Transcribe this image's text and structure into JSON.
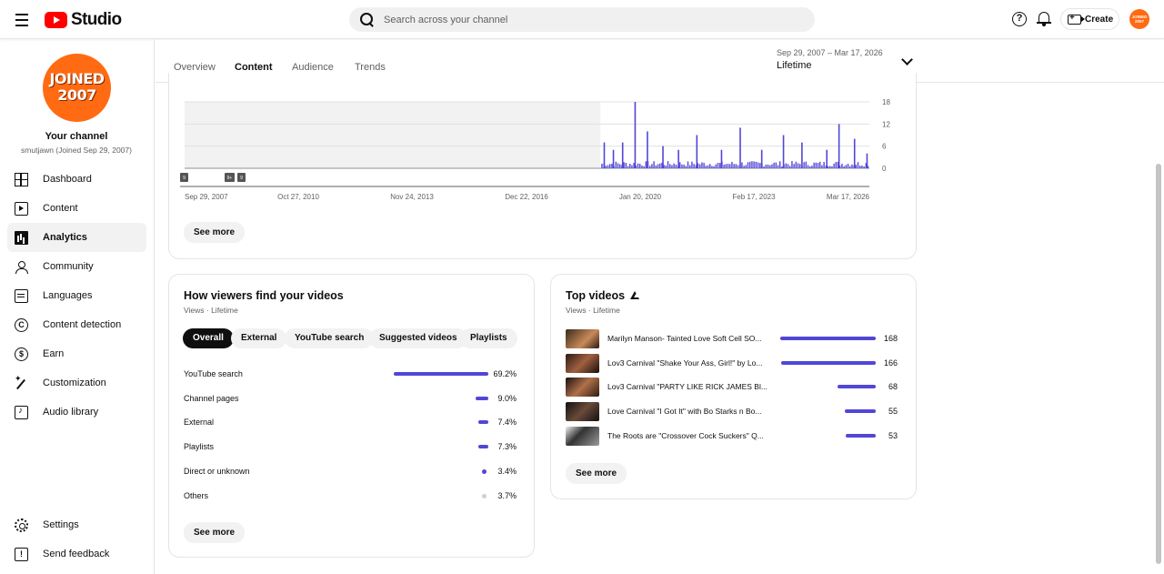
{
  "app": {
    "logo_text": "Studio"
  },
  "search": {
    "placeholder": "Search across your channel"
  },
  "header": {
    "create_label": "Create",
    "avatar_text": "JOINED 2007"
  },
  "sidebar": {
    "avatar_line1": "JOINED",
    "avatar_line2": "2007",
    "channel_title": "Your channel",
    "channel_handle": "smutjawn (Joined Sep 29, 2007)",
    "items": [
      {
        "label": "Dashboard",
        "icon": "dashboard-icon"
      },
      {
        "label": "Content",
        "icon": "content-icon"
      },
      {
        "label": "Analytics",
        "icon": "analytics-icon"
      },
      {
        "label": "Community",
        "icon": "community-icon"
      },
      {
        "label": "Languages",
        "icon": "languages-icon"
      },
      {
        "label": "Content detection",
        "icon": "copyright-icon"
      },
      {
        "label": "Earn",
        "icon": "dollar-icon"
      },
      {
        "label": "Customization",
        "icon": "wand-icon"
      },
      {
        "label": "Audio library",
        "icon": "audio-library-icon"
      }
    ],
    "bottom": [
      {
        "label": "Settings",
        "icon": "gear-icon"
      },
      {
        "label": "Send feedback",
        "icon": "feedback-icon"
      }
    ]
  },
  "tabs": [
    {
      "label": "Overview"
    },
    {
      "label": "Content",
      "active": true
    },
    {
      "label": "Audience"
    },
    {
      "label": "Trends"
    }
  ],
  "date_range": {
    "range": "Sep 29, 2007 – Mar 17, 2026",
    "value": "Lifetime"
  },
  "chart": {
    "see_more": "See more",
    "markers": [
      "9",
      "9+",
      "9"
    ]
  },
  "chart_data": {
    "type": "bar",
    "x_tick_labels": [
      "Sep 29, 2007",
      "Oct 27, 2010",
      "Nov 24, 2013",
      "Dec 22, 2016",
      "Jan 20, 2020",
      "Feb 17, 2023",
      "Mar 17, 2026"
    ],
    "y_tick_labels": [
      "18",
      "12",
      "6",
      "0"
    ],
    "ylim": [
      0,
      18
    ],
    "shaded_region_until": "2018-12",
    "grid": true,
    "colors": {
      "bar": "#5246d6",
      "shaded": "#f2f2f2"
    },
    "peaks": [
      {
        "x": "2019-01",
        "y": 7
      },
      {
        "x": "2019-04",
        "y": 5
      },
      {
        "x": "2019-07",
        "y": 7
      },
      {
        "x": "2019-11",
        "y": 18
      },
      {
        "x": "2020-03",
        "y": 10
      },
      {
        "x": "2020-08",
        "y": 6
      },
      {
        "x": "2021-01",
        "y": 5
      },
      {
        "x": "2021-07",
        "y": 9
      },
      {
        "x": "2022-03",
        "y": 5
      },
      {
        "x": "2022-09",
        "y": 11
      },
      {
        "x": "2023-04",
        "y": 5
      },
      {
        "x": "2023-11",
        "y": 9
      },
      {
        "x": "2024-05",
        "y": 7
      },
      {
        "x": "2025-01",
        "y": 5
      },
      {
        "x": "2025-05",
        "y": 12
      },
      {
        "x": "2025-10",
        "y": 8
      },
      {
        "x": "2026-02",
        "y": 4
      }
    ]
  },
  "traffic": {
    "title": "How viewers find your videos",
    "subtitle": "Views · Lifetime",
    "filters": [
      {
        "label": "Overall",
        "selected": true
      },
      {
        "label": "External"
      },
      {
        "label": "YouTube search"
      },
      {
        "label": "Suggested videos"
      },
      {
        "label": "Playlists"
      }
    ],
    "rows": [
      {
        "label": "YouTube search",
        "value": "69.2%",
        "fraction": 0.692,
        "color": "#5246d6"
      },
      {
        "label": "Channel pages",
        "value": "9.0%",
        "fraction": 0.09,
        "color": "#5246d6"
      },
      {
        "label": "External",
        "value": "7.4%",
        "fraction": 0.074,
        "color": "#5246d6"
      },
      {
        "label": "Playlists",
        "value": "7.3%",
        "fraction": 0.073,
        "color": "#5246d6"
      },
      {
        "label": "Direct or unknown",
        "value": "3.4%",
        "fraction": 0.034,
        "color": "#5246d6"
      },
      {
        "label": "Others",
        "value": "3.7%",
        "fraction": 0.037,
        "color": "#d0d0d0"
      }
    ],
    "see_more": "See more"
  },
  "top_videos": {
    "title": "Top videos",
    "subtitle": "Views · Lifetime",
    "items": [
      {
        "title": "Marilyn Manson- Tainted Love Soft Cell SO...",
        "views": "168",
        "value": 168
      },
      {
        "title": "Lov3 Carnival \"Shake Your Ass, Girl!\" by Lo...",
        "views": "166",
        "value": 166
      },
      {
        "title": "Lov3 Carnival \"PARTY LIKE RICK JAMES Bl...",
        "views": "68",
        "value": 68
      },
      {
        "title": "Love Carnival \"I Got It\" with Bo Starks n Bo...",
        "views": "55",
        "value": 55
      },
      {
        "title": "The Roots are \"Crossover Cock Suckers\" Q...",
        "views": "53",
        "value": 53
      }
    ],
    "see_more": "See more"
  }
}
